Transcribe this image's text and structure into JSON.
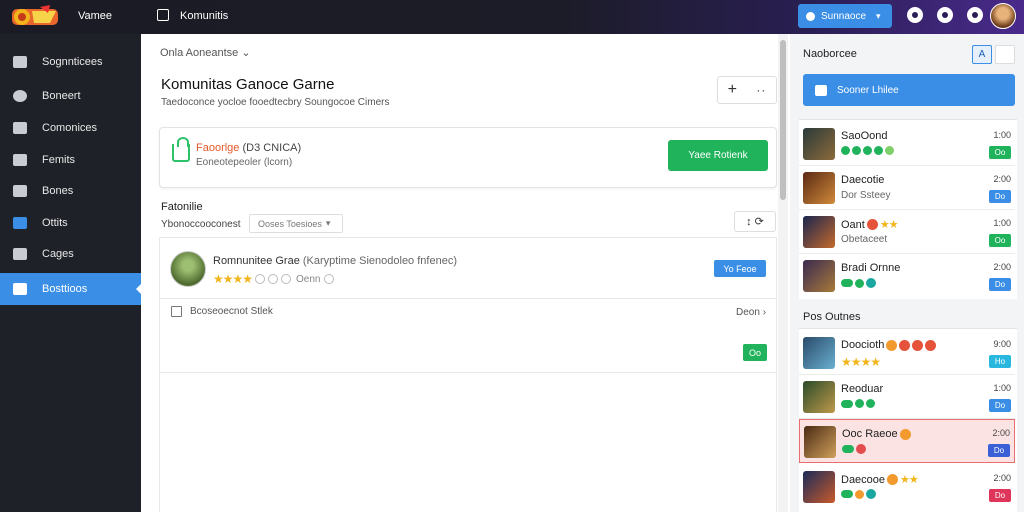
{
  "topbar": {
    "app_name": "Vamee",
    "tab_label": "Komunitis",
    "action_button": "Sunnaoce",
    "action_chevron": "▾",
    "bg_color": "#1a1b24",
    "accent_color": "#3a8ee6"
  },
  "sidebar": {
    "items": [
      {
        "label": "Sognnticees",
        "icon": "home-icon",
        "active": false
      },
      {
        "label": "Boneert",
        "icon": "clock-icon",
        "active": false
      },
      {
        "label": "Comonices",
        "icon": "list-icon",
        "active": false
      },
      {
        "label": "Femits",
        "icon": "building-icon",
        "active": false
      },
      {
        "label": "Bones",
        "icon": "folder-icon",
        "active": false
      },
      {
        "label": "Ottits",
        "icon": "mail-icon",
        "active": false
      },
      {
        "label": "Cages",
        "icon": "grid-icon",
        "active": false
      },
      {
        "label": "Bosttioos",
        "icon": "document-icon",
        "active": true
      }
    ]
  },
  "main": {
    "breadcrumb": "Onla Aoneantse",
    "breadcrumb_chevron": "⌄",
    "title": "Komunitas Ganoce Garne",
    "subtitle": "Taedoconce yocloe fooedtecbry Soungocoe Cimers",
    "tool_plus": "+",
    "tool_more": "··",
    "notice": {
      "title_highlight": "Faoorlge",
      "title_rest": "(D3 CNICA)",
      "subtitle": "Eoneotepeoler (lcorn)",
      "button": "Yaee Rotienk"
    },
    "section_title": "Fatonilie",
    "section_sub": "Ybonoccooconest",
    "filter_label": "Ooses Toesioes",
    "filter_chevron": "▾",
    "section_tools": "↕ ⟳",
    "post": {
      "title": "Romnunitee Grae",
      "title_dim": "(Karyptime Sienodoleo fnfenec)",
      "rating_stars": "★★★★",
      "meta_text": "Oenn",
      "chip": "Yo Feoe",
      "checkbox_label": "Bcoseoecnot Stlek",
      "row_right": "Deon",
      "row_right_chevron": "›",
      "green_chip": "Oo"
    }
  },
  "right_panel": {
    "title": "Naoborcee",
    "sort_label": "A",
    "cta": "Sooner Lhilee",
    "section2_title": "Pos Outnes",
    "items_top": [
      {
        "name": "SaoOond",
        "badge_type": "pills",
        "num": "1:00",
        "chip": "Oo",
        "chip_color": "#21b35b",
        "thumb_a": "#2a3a3a",
        "thumb_b": "#8c6a3a"
      },
      {
        "name": "Daecotie",
        "sub": "Dor Ssteey",
        "num": "2:00",
        "chip": "Do",
        "chip_color": "#3a8ee6",
        "thumb_a": "#5a2a14",
        "thumb_b": "#d08a3a"
      },
      {
        "name": "Oant",
        "name_stars": "★★",
        "sub": "Obetaceet",
        "num": "1:00",
        "chip": "Oo",
        "chip_color": "#21b35b",
        "thumb_a": "#1a2550",
        "thumb_b": "#c46a2a"
      },
      {
        "name": "Bradi Ornne",
        "badge_type": "pill-teal",
        "num": "2:00",
        "chip": "Do",
        "chip_color": "#3a8ee6",
        "thumb_a": "#3a2a50",
        "thumb_b": "#a87a3a"
      }
    ],
    "items_bottom": [
      {
        "name": "Doocioth",
        "name_emojis": true,
        "stars": "★★★★",
        "num": "9:00",
        "chip": "Ho",
        "chip_color": "#29b7e0",
        "thumb_a": "#2a4a6a",
        "thumb_b": "#6ab0d0",
        "highlight": false
      },
      {
        "name": "Reoduar",
        "badge_type": "pill-green",
        "num": "1:00",
        "chip": "Do",
        "chip_color": "#3a8ee6",
        "thumb_a": "#2a4a2a",
        "thumb_b": "#c09a4a",
        "highlight": false
      },
      {
        "name": "Ooc Raeoe",
        "name_emoji": true,
        "badge_type": "pill-red",
        "num": "2:00",
        "chip": "Do",
        "chip_color": "#3a5fd6",
        "thumb_a": "#4a2a14",
        "thumb_b": "#d0a05a",
        "highlight": true
      },
      {
        "name": "Daecooe",
        "name_stars": "★★",
        "badge_type": "pill-teal",
        "num": "2:00",
        "chip": "Do",
        "chip_color": "#e0355a",
        "thumb_a": "#1a2a5a",
        "thumb_b": "#c85a2a",
        "highlight": false
      }
    ]
  }
}
